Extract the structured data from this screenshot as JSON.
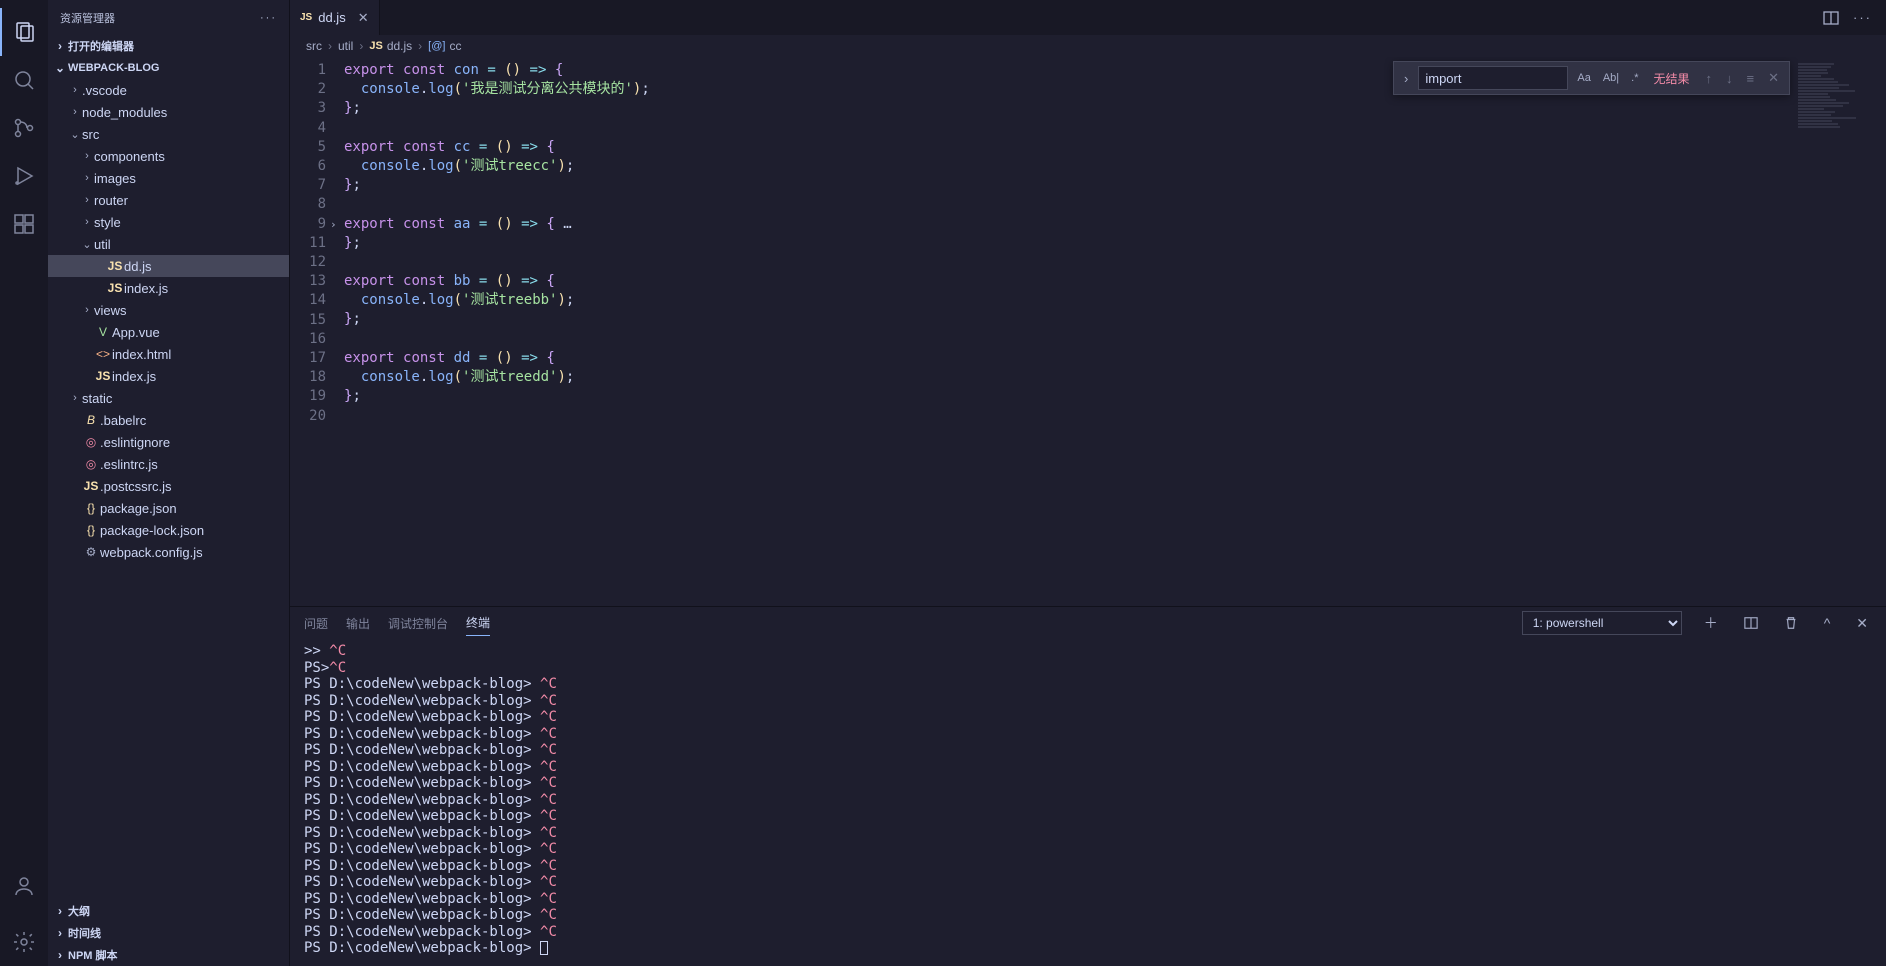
{
  "sidebar": {
    "title": "资源管理器",
    "sections": {
      "openEditors": "打开的编辑器",
      "project": "WEBPACK-BLOG",
      "outline": "大纲",
      "timeline": "时间线",
      "npm": "NPM 脚本"
    },
    "tree": [
      {
        "label": ".vscode",
        "depth": 1,
        "kind": "folder",
        "chev": ">"
      },
      {
        "label": "node_modules",
        "depth": 1,
        "kind": "folder",
        "chev": ">"
      },
      {
        "label": "src",
        "depth": 1,
        "kind": "folder",
        "chev": "v"
      },
      {
        "label": "components",
        "depth": 2,
        "kind": "folder",
        "chev": ">"
      },
      {
        "label": "images",
        "depth": 2,
        "kind": "folder",
        "chev": ">"
      },
      {
        "label": "router",
        "depth": 2,
        "kind": "folder",
        "chev": ">"
      },
      {
        "label": "style",
        "depth": 2,
        "kind": "folder",
        "chev": ">"
      },
      {
        "label": "util",
        "depth": 2,
        "kind": "folder",
        "chev": "v"
      },
      {
        "label": "dd.js",
        "depth": 3,
        "kind": "js",
        "selected": true
      },
      {
        "label": "index.js",
        "depth": 3,
        "kind": "js"
      },
      {
        "label": "views",
        "depth": 2,
        "kind": "folder",
        "chev": ">"
      },
      {
        "label": "App.vue",
        "depth": 2,
        "kind": "vue"
      },
      {
        "label": "index.html",
        "depth": 2,
        "kind": "html"
      },
      {
        "label": "index.js",
        "depth": 2,
        "kind": "js"
      },
      {
        "label": "static",
        "depth": 1,
        "kind": "folder",
        "chev": ">"
      },
      {
        "label": ".babelrc",
        "depth": 1,
        "kind": "babel"
      },
      {
        "label": ".eslintignore",
        "depth": 1,
        "kind": "cfg"
      },
      {
        "label": ".eslintrc.js",
        "depth": 1,
        "kind": "cfg"
      },
      {
        "label": ".postcssrc.js",
        "depth": 1,
        "kind": "js"
      },
      {
        "label": "package.json",
        "depth": 1,
        "kind": "json"
      },
      {
        "label": "package-lock.json",
        "depth": 1,
        "kind": "json"
      },
      {
        "label": "webpack.config.js",
        "depth": 1,
        "kind": "gear"
      }
    ]
  },
  "tab": {
    "label": "dd.js",
    "iconLabel": "JS"
  },
  "breadcrumb": {
    "parts": [
      "src",
      "util",
      "dd.js",
      "cc"
    ],
    "fileIcon": "JS",
    "symbolIcon": "[@]"
  },
  "find": {
    "value": "import",
    "noResults": "无结果",
    "icons": {
      "case": "Aa",
      "word": "Ab|",
      "regex": ".*"
    }
  },
  "code": {
    "lines": [
      {
        "n": 1,
        "t": [
          [
            "kw-exp",
            "export"
          ],
          [
            "sp",
            " "
          ],
          [
            "kw-const",
            "const"
          ],
          [
            "sp",
            " "
          ],
          [
            "fn",
            "con"
          ],
          [
            "sp",
            " "
          ],
          [
            "op",
            "="
          ],
          [
            "sp",
            " "
          ],
          [
            "paren",
            "()"
          ],
          [
            "sp",
            " "
          ],
          [
            "op",
            "=>"
          ],
          [
            "sp",
            " "
          ],
          [
            "brace",
            "{"
          ]
        ]
      },
      {
        "n": 2,
        "t": [
          [
            "sp",
            "  "
          ],
          [
            "obj",
            "console"
          ],
          [
            "dot",
            "."
          ],
          [
            "fn",
            "log"
          ],
          [
            "paren",
            "("
          ],
          [
            "str",
            "'我是测试分离公共模块的'"
          ],
          [
            "paren",
            ")"
          ],
          [
            "dot",
            ";"
          ]
        ]
      },
      {
        "n": 3,
        "t": [
          [
            "brace",
            "}"
          ],
          [
            "dot",
            ";"
          ]
        ]
      },
      {
        "n": 4,
        "t": []
      },
      {
        "n": 5,
        "t": [
          [
            "kw-exp",
            "export"
          ],
          [
            "sp",
            " "
          ],
          [
            "kw-const",
            "const"
          ],
          [
            "sp",
            " "
          ],
          [
            "fn",
            "cc"
          ],
          [
            "sp",
            " "
          ],
          [
            "op",
            "="
          ],
          [
            "sp",
            " "
          ],
          [
            "paren",
            "()"
          ],
          [
            "sp",
            " "
          ],
          [
            "op",
            "=>"
          ],
          [
            "sp",
            " "
          ],
          [
            "brace",
            "{"
          ]
        ]
      },
      {
        "n": 6,
        "t": [
          [
            "sp",
            "  "
          ],
          [
            "obj",
            "console"
          ],
          [
            "dot",
            "."
          ],
          [
            "fn",
            "log"
          ],
          [
            "paren",
            "("
          ],
          [
            "str",
            "'测试treecc'"
          ],
          [
            "paren",
            ")"
          ],
          [
            "dot",
            ";"
          ]
        ]
      },
      {
        "n": 7,
        "t": [
          [
            "brace",
            "}"
          ],
          [
            "dot",
            ";"
          ]
        ]
      },
      {
        "n": 8,
        "t": []
      },
      {
        "n": 9,
        "fold": true,
        "t": [
          [
            "kw-exp",
            "export"
          ],
          [
            "sp",
            " "
          ],
          [
            "kw-const",
            "const"
          ],
          [
            "sp",
            " "
          ],
          [
            "fn",
            "aa"
          ],
          [
            "sp",
            " "
          ],
          [
            "op",
            "="
          ],
          [
            "sp",
            " "
          ],
          [
            "paren",
            "()"
          ],
          [
            "sp",
            " "
          ],
          [
            "op",
            "=>"
          ],
          [
            "sp",
            " "
          ],
          [
            "brace",
            "{"
          ],
          [
            "dot",
            " …"
          ]
        ]
      },
      {
        "n": 11,
        "t": [
          [
            "brace",
            "}"
          ],
          [
            "dot",
            ";"
          ]
        ]
      },
      {
        "n": 12,
        "t": []
      },
      {
        "n": 13,
        "t": [
          [
            "kw-exp",
            "export"
          ],
          [
            "sp",
            " "
          ],
          [
            "kw-const",
            "const"
          ],
          [
            "sp",
            " "
          ],
          [
            "fn",
            "bb"
          ],
          [
            "sp",
            " "
          ],
          [
            "op",
            "="
          ],
          [
            "sp",
            " "
          ],
          [
            "paren",
            "()"
          ],
          [
            "sp",
            " "
          ],
          [
            "op",
            "=>"
          ],
          [
            "sp",
            " "
          ],
          [
            "brace",
            "{"
          ]
        ]
      },
      {
        "n": 14,
        "t": [
          [
            "sp",
            "  "
          ],
          [
            "obj",
            "console"
          ],
          [
            "dot",
            "."
          ],
          [
            "fn",
            "log"
          ],
          [
            "paren",
            "("
          ],
          [
            "str",
            "'测试treebb'"
          ],
          [
            "paren",
            ")"
          ],
          [
            "dot",
            ";"
          ]
        ]
      },
      {
        "n": 15,
        "t": [
          [
            "brace",
            "}"
          ],
          [
            "dot",
            ";"
          ]
        ]
      },
      {
        "n": 16,
        "t": []
      },
      {
        "n": 17,
        "t": [
          [
            "kw-exp",
            "export"
          ],
          [
            "sp",
            " "
          ],
          [
            "kw-const",
            "const"
          ],
          [
            "sp",
            " "
          ],
          [
            "fn",
            "dd"
          ],
          [
            "sp",
            " "
          ],
          [
            "op",
            "="
          ],
          [
            "sp",
            " "
          ],
          [
            "paren",
            "()"
          ],
          [
            "sp",
            " "
          ],
          [
            "op",
            "=>"
          ],
          [
            "sp",
            " "
          ],
          [
            "brace",
            "{"
          ]
        ]
      },
      {
        "n": 18,
        "t": [
          [
            "sp",
            "  "
          ],
          [
            "obj",
            "console"
          ],
          [
            "dot",
            "."
          ],
          [
            "fn",
            "log"
          ],
          [
            "paren",
            "("
          ],
          [
            "str",
            "'测试treedd'"
          ],
          [
            "paren",
            ")"
          ],
          [
            "dot",
            ";"
          ]
        ]
      },
      {
        "n": 19,
        "t": [
          [
            "brace",
            "}"
          ],
          [
            "dot",
            ";"
          ]
        ]
      },
      {
        "n": 20,
        "t": []
      }
    ]
  },
  "panel": {
    "tabs": {
      "problems": "问题",
      "output": "输出",
      "debug": "调试控制台",
      "terminal": "终端"
    },
    "terminalSelect": "1: powershell"
  },
  "terminal": {
    "firstLine": {
      "a": ">> ",
      "b": "^C"
    },
    "secondLine": {
      "a": "PS>",
      "b": "^C"
    },
    "prompt": "PS D:\\codeNew\\webpack-blog> ",
    "ctrlc": "^C",
    "repeatCount": 16
  }
}
